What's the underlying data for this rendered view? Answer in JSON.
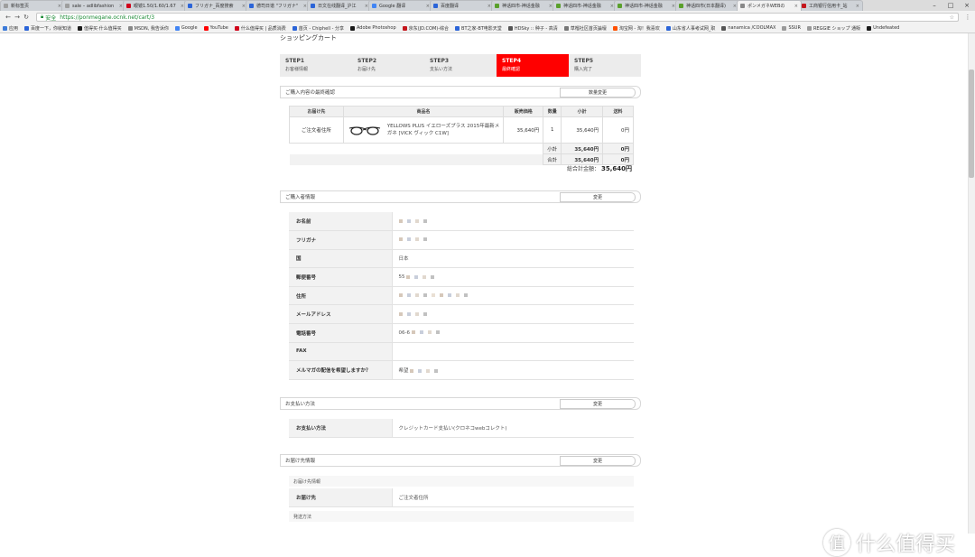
{
  "browser": {
    "tabs": [
      {
        "label": "新标签页",
        "color": "#9e9e9e"
      },
      {
        "label": "sale – adlibfashion",
        "color": "#9e9e9e"
      },
      {
        "label": "眼镜1.50/1.60/1.67",
        "color": "#d0021b"
      },
      {
        "label": "フリガナ_百度搜索",
        "color": "#2b64d8"
      },
      {
        "label": "德司日谱 \"フリガナ\"",
        "color": "#2b64d8"
      },
      {
        "label": "日文在线翻译_沪江",
        "color": "#2b64d8"
      },
      {
        "label": "Google 翻译",
        "color": "#4285f4"
      },
      {
        "label": "百度翻译",
        "color": "#2b64d8"
      },
      {
        "label": "神话四市-神话金融",
        "color": "#5aa02c"
      },
      {
        "label": "神话四市-神话金融",
        "color": "#5aa02c"
      },
      {
        "label": "神话四市-神话金融",
        "color": "#5aa02c"
      },
      {
        "label": "神话四市(日本翻译)",
        "color": "#5aa02c"
      },
      {
        "label": "ポンメガネWEBの",
        "color": "#888888",
        "active": true
      },
      {
        "label": "工商银行信用卡_站",
        "color": "#c4161c"
      }
    ],
    "address": {
      "secure_label": "安全",
      "url": "https://ponmegane.ocnk.net/cart/3"
    },
    "bookmarks": [
      {
        "label": "应用",
        "color": "#3d7bd9"
      },
      {
        "label": "百度一下，你就知道",
        "color": "#2b64d8"
      },
      {
        "label": "值得买·什么值得买",
        "color": "#1a1a1a"
      },
      {
        "label": "MSDN, 我告诉你",
        "color": "#888888"
      },
      {
        "label": "Google",
        "color": "#4285f4"
      },
      {
        "label": "YouTube",
        "color": "#ff0000"
      },
      {
        "label": "什么值得买 | 品质消费",
        "color": "#d0021b"
      },
      {
        "label": "首页 - Chiphell - 分享",
        "color": "#2b64d8"
      },
      {
        "label": "Adobe Photoshop",
        "color": "#1a1a1a"
      },
      {
        "label": "京东(JD.COM)-综合",
        "color": "#c4161c"
      },
      {
        "label": "BT之家-BT电影天堂",
        "color": "#2b64d8"
      },
      {
        "label": "HDSky :: 种子 - 高清",
        "color": "#555555"
      },
      {
        "label": "草榴社区首页論壇",
        "color": "#777777"
      },
      {
        "label": "淘宝网 - 淘！我喜欢",
        "color": "#ff5000"
      },
      {
        "label": "山东省人事考试网_职",
        "color": "#2b64d8"
      },
      {
        "label": "nanamica /COOLMAX",
        "color": "#555555"
      },
      {
        "label": "SSUR",
        "color": "#999999"
      },
      {
        "label": "REGGIE ショップ 通販",
        "color": "#999999"
      },
      {
        "label": "Undefeated",
        "color": "#1a1a1a"
      }
    ]
  },
  "page": {
    "cart_title": "ショッピングカート",
    "steps": [
      {
        "num": "STEP1",
        "label": "お客様情報"
      },
      {
        "num": "STEP2",
        "label": "お届け先"
      },
      {
        "num": "STEP3",
        "label": "支払い方法"
      },
      {
        "num": "STEP4",
        "label": "最終確認",
        "active": true
      },
      {
        "num": "STEP5",
        "label": "購入完了"
      }
    ],
    "accent_color": "#ff0000",
    "order": {
      "heading": "ご購入内容の最終確認",
      "button": "数量変更",
      "columns": [
        "お届け先",
        "商品名",
        "販売価格",
        "数量",
        "小計",
        "送料"
      ],
      "row": {
        "destination": "ご注文者住所",
        "product": "YELLOWS PLUS イエローズプラス 2015年最新メガネ [VICK ヴィック C1W]",
        "price": "35,640円",
        "qty": "1",
        "subtotal": "35,640円",
        "shipping": "0円"
      },
      "subtotal_label": "小計",
      "subtotal_value": "35,640円",
      "subtotal_ship": "0円",
      "total_label": "合計",
      "total_value": "35,640円",
      "total_ship": "0円",
      "grand_label": "総合計金額：",
      "grand_value": "35,640円"
    },
    "buyer": {
      "heading": "ご購入者情報",
      "button": "変更",
      "fields": [
        {
          "label": "お名前",
          "value": ""
        },
        {
          "label": "フリガナ",
          "value": ""
        },
        {
          "label": "国",
          "value": "日本"
        },
        {
          "label": "郵便番号",
          "value": "55"
        },
        {
          "label": "住所",
          "value": ""
        },
        {
          "label": "メールアドレス",
          "value": ""
        },
        {
          "label": "電話番号",
          "value": "06-6"
        },
        {
          "label": "FAX",
          "value": ""
        },
        {
          "label": "メルマガの配信を希望しますか？",
          "value": "希望"
        }
      ]
    },
    "payment": {
      "heading": "お支払い方法",
      "button": "変更",
      "label": "お支払い方法",
      "value": "クレジットカード支払い(クロネコwebコレクト)"
    },
    "delivery": {
      "heading": "お届け先情報",
      "button": "変更",
      "sub_heading": "お届け先情報",
      "label": "お届け先",
      "value": "ご注文者住所",
      "method_heading": "発送方法"
    },
    "watermark": "什么值得买",
    "watermark_glyph": "值"
  }
}
